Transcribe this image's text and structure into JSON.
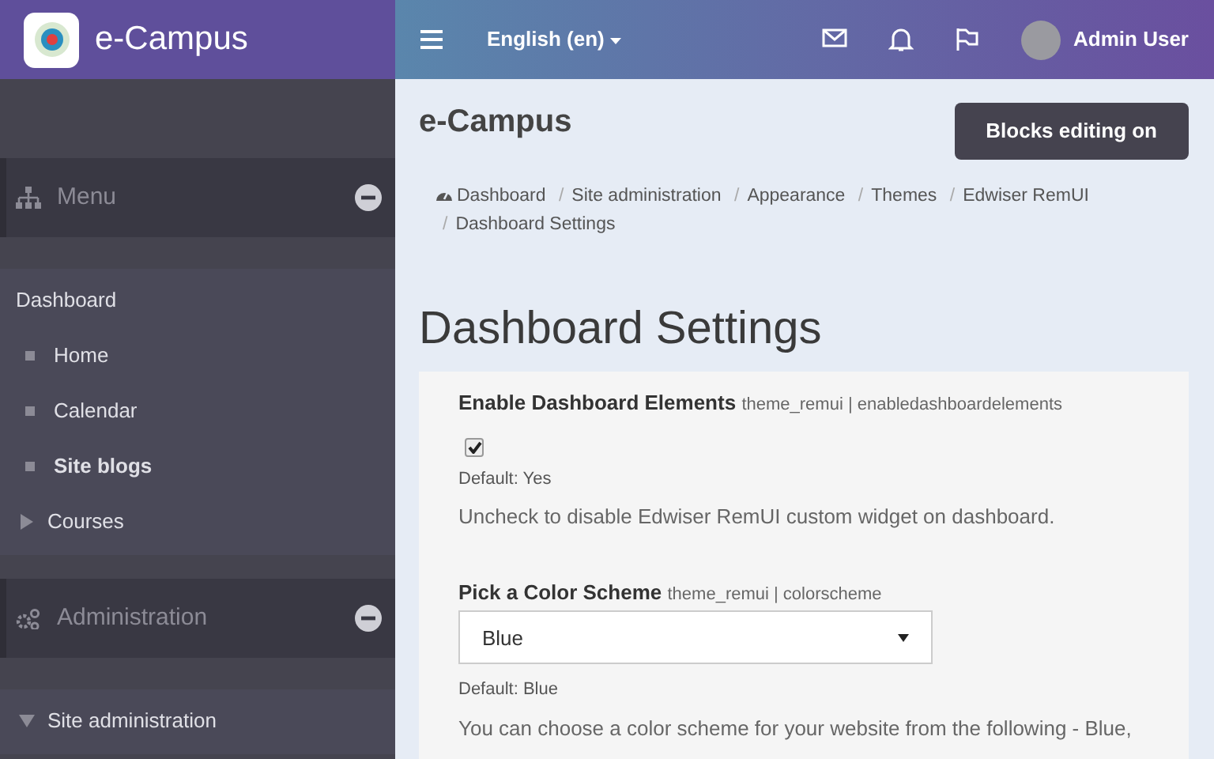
{
  "brand": {
    "title": "e-Campus"
  },
  "topbar": {
    "language": "English (en)",
    "user": "Admin User"
  },
  "sidebar": {
    "blocks": [
      {
        "title": "Menu",
        "expanded": true,
        "items": [
          {
            "label": "Dashboard",
            "kind": "plain",
            "current": false
          },
          {
            "label": "Home",
            "kind": "leaf",
            "current": false
          },
          {
            "label": "Calendar",
            "kind": "leaf",
            "current": false
          },
          {
            "label": "Site blogs",
            "kind": "leaf",
            "current": true
          },
          {
            "label": "Courses",
            "kind": "branch",
            "expanded": false,
            "current": false
          }
        ]
      },
      {
        "title": "Administration",
        "expanded": true,
        "items": [
          {
            "label": "Site administration",
            "kind": "branch",
            "expanded": true,
            "current": false
          }
        ]
      }
    ]
  },
  "page": {
    "site_title": "e-Campus",
    "edit_button": "Blocks editing on",
    "breadcrumb": [
      {
        "label": "Dashboard"
      },
      {
        "separator": "/",
        "label": "Site administration"
      },
      {
        "separator": "/",
        "label": "Appearance"
      },
      {
        "separator": "/",
        "label": "Themes"
      },
      {
        "separator": "/",
        "label": "Edwiser RemUI"
      },
      {
        "separator": "/",
        "label": "Dashboard Settings"
      }
    ],
    "heading": "Dashboard Settings",
    "settings": [
      {
        "kind": "checkbox",
        "title": "Enable Dashboard Elements",
        "key": "theme_remui | enabledashboardelements",
        "checked": true,
        "default": "Default: Yes",
        "description": "Uncheck to disable Edwiser RemUI custom widget on dashboard."
      },
      {
        "kind": "select",
        "title": "Pick a Color Scheme",
        "key": "theme_remui | colorscheme",
        "value": "Blue",
        "default": "Default: Blue",
        "description": "You can choose a color scheme for your website from the following - Blue,"
      }
    ]
  }
}
